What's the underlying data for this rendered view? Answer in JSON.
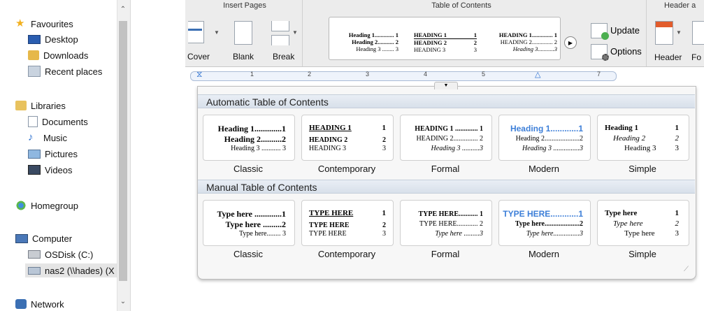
{
  "explorer": {
    "items": [
      {
        "label": "Favourites",
        "icon": "star-icon"
      },
      {
        "label": "Desktop",
        "icon": "desktop-icon"
      },
      {
        "label": "Downloads",
        "icon": "downloads-icon"
      },
      {
        "label": "Recent places",
        "icon": "recent-places-icon"
      },
      {
        "label": "Libraries",
        "icon": "libraries-icon"
      },
      {
        "label": "Documents",
        "icon": "documents-icon"
      },
      {
        "label": "Music",
        "icon": "music-icon"
      },
      {
        "label": "Pictures",
        "icon": "pictures-icon"
      },
      {
        "label": "Videos",
        "icon": "videos-icon"
      },
      {
        "label": "Homegroup",
        "icon": "homegroup-icon"
      },
      {
        "label": "Computer",
        "icon": "computer-icon"
      },
      {
        "label": "OSDisk (C:)",
        "icon": "drive-icon"
      },
      {
        "label": "nas2 (\\\\hades) (X",
        "icon": "network-drive-icon"
      },
      {
        "label": "Network",
        "icon": "network-icon"
      }
    ]
  },
  "ribbon": {
    "groups": {
      "insert_pages": "Insert Pages",
      "toc": "Table of Contents",
      "header": "Header a"
    },
    "buttons": {
      "cover": "Cover",
      "blank": "Blank",
      "break": "Break",
      "update": "Update",
      "options": "Options",
      "header": "Header",
      "footer": "Fo"
    },
    "gallery": {
      "classic": [
        "Heading 1............. 1",
        "Heading 2........... 2",
        "Heading 3 ........ 3"
      ],
      "contemporary": [
        "HEADING 1",
        "1",
        "HEADING 2",
        "2",
        "HEADING 3",
        "3"
      ],
      "formal": [
        "HEADING 1.............. 1",
        "HEADING 2.............. 2",
        "Heading 3...........3"
      ]
    }
  },
  "ruler": {
    "numbers": [
      "1",
      "2",
      "3",
      "4",
      "5",
      "7"
    ]
  },
  "panel": {
    "auto_title": "Automatic Table of Contents",
    "manual_title": "Manual Table of Contents",
    "styles": [
      "Classic",
      "Contemporary",
      "Formal",
      "Modern",
      "Simple"
    ],
    "auto": {
      "classic": [
        "Heading 1.............1",
        "Heading 2..........2",
        "Heading 3 ........... 3"
      ],
      "contemporary": [
        "HEADING 1",
        "1",
        "HEADING 2",
        "2",
        "HEADING 3",
        "3"
      ],
      "formal": [
        "HEADING 1 ............. 1",
        "HEADING 2.............. 2",
        "Heading 3 ..........3"
      ],
      "modern": [
        "Heading 1............1",
        "Heading 2....................2",
        "Heading 3 ...............3"
      ],
      "simple": [
        "Heading 1",
        "1",
        "Heading 2",
        "2",
        "Heading 3",
        "3"
      ]
    },
    "manual": {
      "classic": [
        "Type here .............1",
        "Type here .........2",
        "Type here........ 3"
      ],
      "contemporary": [
        "TYPE HERE",
        "1",
        "TYPE HERE",
        "2",
        "TYPE HERE",
        "3"
      ],
      "formal": [
        "TYPE HERE........... 1",
        "TYPE HERE............ 2",
        "Type here .........3"
      ],
      "modern": [
        "TYPE HERE............1",
        "Type here....................2",
        "Type here...............3"
      ],
      "simple": [
        "Type here",
        "1",
        "Type here",
        "2",
        "Type here",
        "3"
      ]
    },
    "accent": "#3d7fd8"
  }
}
